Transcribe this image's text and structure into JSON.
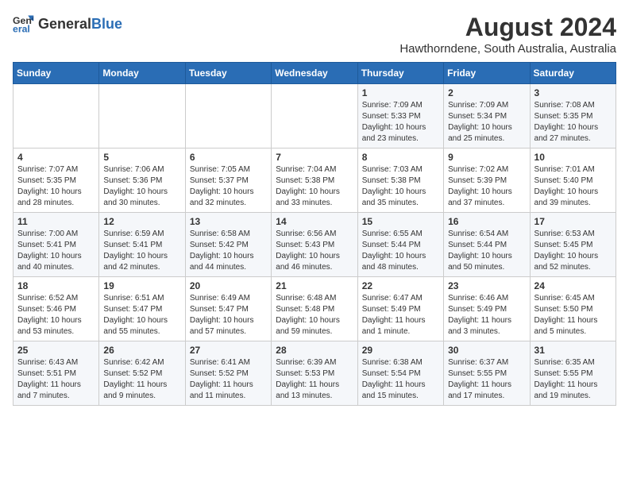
{
  "logo": {
    "general": "General",
    "blue": "Blue"
  },
  "title": "August 2024",
  "subtitle": "Hawthorndene, South Australia, Australia",
  "weekdays": [
    "Sunday",
    "Monday",
    "Tuesday",
    "Wednesday",
    "Thursday",
    "Friday",
    "Saturday"
  ],
  "weeks": [
    [
      {
        "day": "",
        "content": ""
      },
      {
        "day": "",
        "content": ""
      },
      {
        "day": "",
        "content": ""
      },
      {
        "day": "",
        "content": ""
      },
      {
        "day": "1",
        "content": "Sunrise: 7:09 AM\nSunset: 5:33 PM\nDaylight: 10 hours\nand 23 minutes."
      },
      {
        "day": "2",
        "content": "Sunrise: 7:09 AM\nSunset: 5:34 PM\nDaylight: 10 hours\nand 25 minutes."
      },
      {
        "day": "3",
        "content": "Sunrise: 7:08 AM\nSunset: 5:35 PM\nDaylight: 10 hours\nand 27 minutes."
      }
    ],
    [
      {
        "day": "4",
        "content": "Sunrise: 7:07 AM\nSunset: 5:35 PM\nDaylight: 10 hours\nand 28 minutes."
      },
      {
        "day": "5",
        "content": "Sunrise: 7:06 AM\nSunset: 5:36 PM\nDaylight: 10 hours\nand 30 minutes."
      },
      {
        "day": "6",
        "content": "Sunrise: 7:05 AM\nSunset: 5:37 PM\nDaylight: 10 hours\nand 32 minutes."
      },
      {
        "day": "7",
        "content": "Sunrise: 7:04 AM\nSunset: 5:38 PM\nDaylight: 10 hours\nand 33 minutes."
      },
      {
        "day": "8",
        "content": "Sunrise: 7:03 AM\nSunset: 5:38 PM\nDaylight: 10 hours\nand 35 minutes."
      },
      {
        "day": "9",
        "content": "Sunrise: 7:02 AM\nSunset: 5:39 PM\nDaylight: 10 hours\nand 37 minutes."
      },
      {
        "day": "10",
        "content": "Sunrise: 7:01 AM\nSunset: 5:40 PM\nDaylight: 10 hours\nand 39 minutes."
      }
    ],
    [
      {
        "day": "11",
        "content": "Sunrise: 7:00 AM\nSunset: 5:41 PM\nDaylight: 10 hours\nand 40 minutes."
      },
      {
        "day": "12",
        "content": "Sunrise: 6:59 AM\nSunset: 5:41 PM\nDaylight: 10 hours\nand 42 minutes."
      },
      {
        "day": "13",
        "content": "Sunrise: 6:58 AM\nSunset: 5:42 PM\nDaylight: 10 hours\nand 44 minutes."
      },
      {
        "day": "14",
        "content": "Sunrise: 6:56 AM\nSunset: 5:43 PM\nDaylight: 10 hours\nand 46 minutes."
      },
      {
        "day": "15",
        "content": "Sunrise: 6:55 AM\nSunset: 5:44 PM\nDaylight: 10 hours\nand 48 minutes."
      },
      {
        "day": "16",
        "content": "Sunrise: 6:54 AM\nSunset: 5:44 PM\nDaylight: 10 hours\nand 50 minutes."
      },
      {
        "day": "17",
        "content": "Sunrise: 6:53 AM\nSunset: 5:45 PM\nDaylight: 10 hours\nand 52 minutes."
      }
    ],
    [
      {
        "day": "18",
        "content": "Sunrise: 6:52 AM\nSunset: 5:46 PM\nDaylight: 10 hours\nand 53 minutes."
      },
      {
        "day": "19",
        "content": "Sunrise: 6:51 AM\nSunset: 5:47 PM\nDaylight: 10 hours\nand 55 minutes."
      },
      {
        "day": "20",
        "content": "Sunrise: 6:49 AM\nSunset: 5:47 PM\nDaylight: 10 hours\nand 57 minutes."
      },
      {
        "day": "21",
        "content": "Sunrise: 6:48 AM\nSunset: 5:48 PM\nDaylight: 10 hours\nand 59 minutes."
      },
      {
        "day": "22",
        "content": "Sunrise: 6:47 AM\nSunset: 5:49 PM\nDaylight: 11 hours\nand 1 minute."
      },
      {
        "day": "23",
        "content": "Sunrise: 6:46 AM\nSunset: 5:49 PM\nDaylight: 11 hours\nand 3 minutes."
      },
      {
        "day": "24",
        "content": "Sunrise: 6:45 AM\nSunset: 5:50 PM\nDaylight: 11 hours\nand 5 minutes."
      }
    ],
    [
      {
        "day": "25",
        "content": "Sunrise: 6:43 AM\nSunset: 5:51 PM\nDaylight: 11 hours\nand 7 minutes."
      },
      {
        "day": "26",
        "content": "Sunrise: 6:42 AM\nSunset: 5:52 PM\nDaylight: 11 hours\nand 9 minutes."
      },
      {
        "day": "27",
        "content": "Sunrise: 6:41 AM\nSunset: 5:52 PM\nDaylight: 11 hours\nand 11 minutes."
      },
      {
        "day": "28",
        "content": "Sunrise: 6:39 AM\nSunset: 5:53 PM\nDaylight: 11 hours\nand 13 minutes."
      },
      {
        "day": "29",
        "content": "Sunrise: 6:38 AM\nSunset: 5:54 PM\nDaylight: 11 hours\nand 15 minutes."
      },
      {
        "day": "30",
        "content": "Sunrise: 6:37 AM\nSunset: 5:55 PM\nDaylight: 11 hours\nand 17 minutes."
      },
      {
        "day": "31",
        "content": "Sunrise: 6:35 AM\nSunset: 5:55 PM\nDaylight: 11 hours\nand 19 minutes."
      }
    ]
  ]
}
